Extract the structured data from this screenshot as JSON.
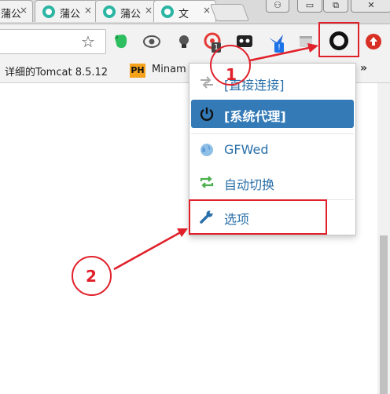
{
  "tabs": [
    {
      "title": "蒲公"
    },
    {
      "title": "蒲公"
    },
    {
      "title": "蒲公"
    },
    {
      "title": "文"
    }
  ],
  "tab_close_glyph": "×",
  "window_controls": {
    "profile": "⚇",
    "minimize": "▭",
    "restore": "⧉",
    "close": "✕"
  },
  "toolbar": {
    "star_glyph": "☆",
    "extensions": [
      {
        "name": "evernote-icon",
        "color": "#2dbe60"
      },
      {
        "name": "eye-icon",
        "color": "#555555"
      },
      {
        "name": "bulb-icon",
        "color": "#444444"
      },
      {
        "name": "target-icon",
        "color": "#e53935",
        "badge": "1"
      },
      {
        "name": "ghost-icon",
        "color": "#222222"
      },
      {
        "name": "bird-icon",
        "color": "#2b6cd9",
        "badge": "!"
      },
      {
        "name": "grey-box-icon",
        "color": "#c8c8c8"
      }
    ],
    "upload_color": "#d93025"
  },
  "bookmarks": {
    "item1": "详细的Tomcat 8.5.12",
    "ph_badge": "PH",
    "item2": "Minam",
    "more_glyph": "»"
  },
  "menu": {
    "items": [
      {
        "label": "[直接连接]",
        "icon": "arrows-icon"
      },
      {
        "label": "[系统代理]",
        "icon": "power-icon",
        "active": true
      },
      {
        "label": "GFWed",
        "icon": "globe-icon"
      },
      {
        "label": "自动切换",
        "icon": "refresh-icon"
      },
      {
        "label": "选项",
        "icon": "wrench-icon"
      }
    ]
  },
  "annotations": {
    "label1": "1",
    "label2": "2",
    "color": "#e0202a"
  }
}
